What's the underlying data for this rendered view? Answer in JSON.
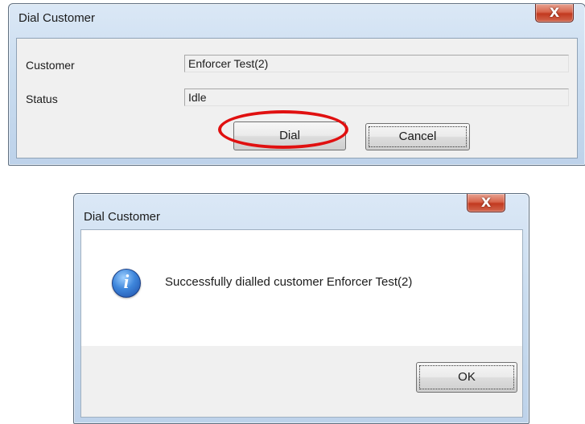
{
  "dial_dialog": {
    "title": "Dial Customer",
    "close_label": "X",
    "customer_label": "Customer",
    "customer_value": "Enforcer Test(2)",
    "status_label": "Status",
    "status_value": "Idle",
    "dial_button": "Dial",
    "cancel_button": "Cancel"
  },
  "result_dialog": {
    "title": "Dial Customer",
    "close_label": "X",
    "icon": "info-icon",
    "message": "Successfully dialled customer Enforcer Test(2)",
    "ok_button": "OK"
  },
  "annotation": {
    "highlight_color": "#e01010"
  }
}
